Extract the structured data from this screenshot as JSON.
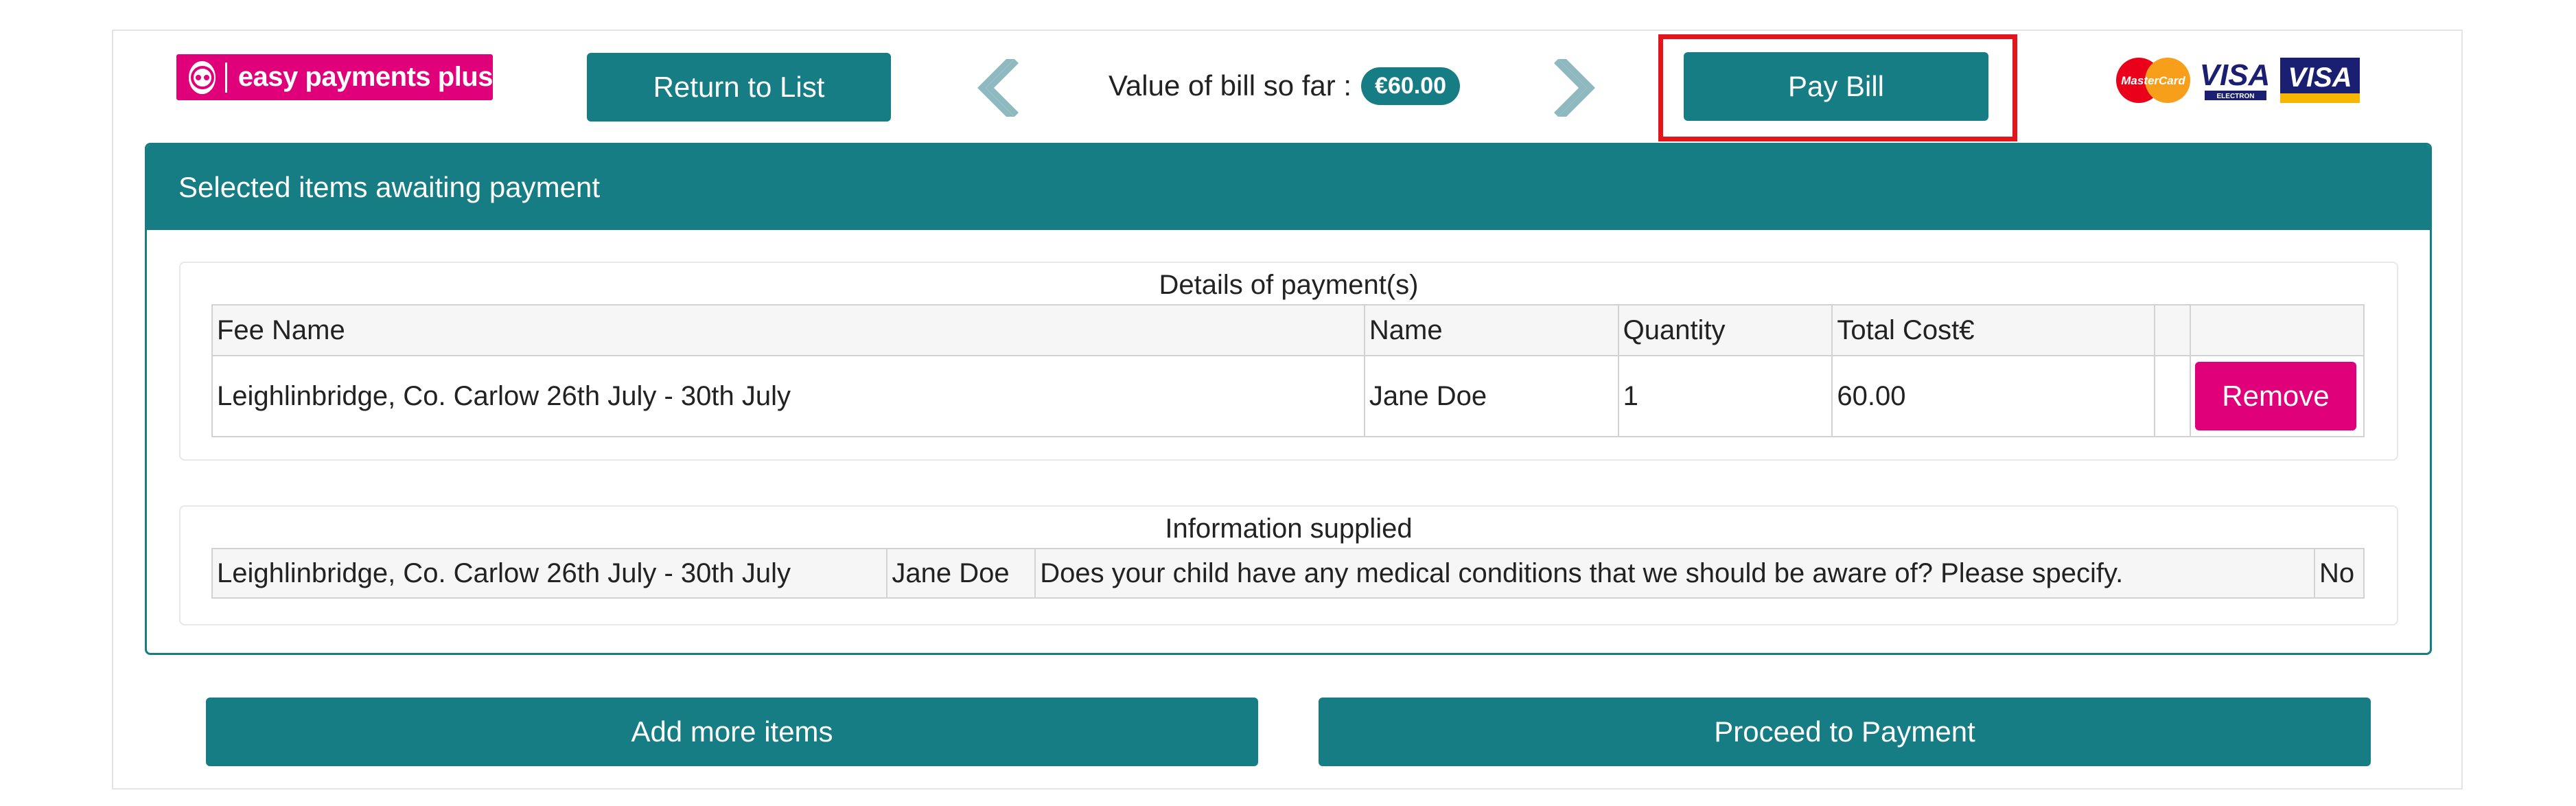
{
  "header": {
    "logo_text": "easy payments plus",
    "return_label": "Return to List",
    "bill_label": "Value of bill so far :",
    "bill_value": "€60.00",
    "pay_bill_label": "Pay Bill",
    "prev_icon": "chevron-left-icon",
    "next_icon": "chevron-right-icon",
    "card_logos": {
      "mastercard": "MasterCard",
      "visa_electron": "VISA",
      "visa_electron_sub": "ELECTRON",
      "visa": "VISA"
    }
  },
  "panel": {
    "title": "Selected items awaiting payment",
    "details": {
      "title": "Details of payment(s)",
      "columns": [
        "Fee Name",
        "Name",
        "Quantity",
        "Total Cost€",
        ""
      ],
      "rows": [
        {
          "fee_name": "Leighlinbridge, Co. Carlow 26th July - 30th July",
          "name": "Jane Doe",
          "quantity": "1",
          "total": "60.00",
          "remove_label": "Remove"
        }
      ]
    },
    "info": {
      "title": "Information supplied",
      "rows": [
        {
          "fee_name": "Leighlinbridge, Co. Carlow 26th July - 30th July",
          "name": "Jane Doe",
          "question": "Does your child have any medical conditions that we should be aware of? Please specify.",
          "answer": "No"
        }
      ]
    }
  },
  "footer": {
    "add_label": "Add more items",
    "proceed_label": "Proceed to Payment"
  },
  "colors": {
    "teal": "#167d84",
    "magenta": "#e0007a",
    "highlight": "#e2141c",
    "arrow": "#8fb9c0"
  }
}
